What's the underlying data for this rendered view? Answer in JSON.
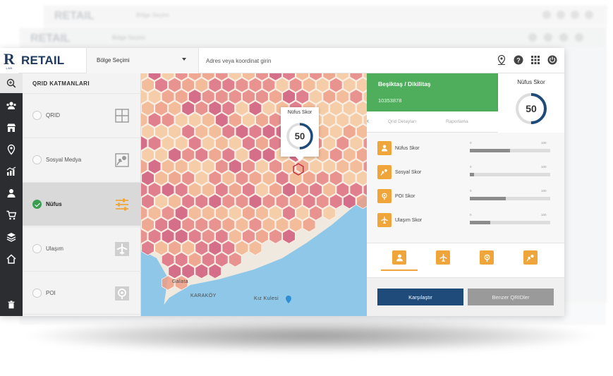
{
  "app": {
    "logo_text": "RETAIL",
    "logo_letter": "R",
    "logo_sub": "LAB",
    "region_select": "Bölge Seçimi",
    "search_placeholder": "Adres veya koordinat girin"
  },
  "ghost": {
    "logo_text": "RETAIL",
    "region_select": "Bölge Seçimi"
  },
  "toolbar": {
    "icons": [
      "map-pin-icon",
      "help-icon",
      "grid-menu-icon",
      "power-icon"
    ]
  },
  "rail": {
    "icons": [
      "layers-search-icon",
      "users-icon",
      "store-icon",
      "location-icon",
      "chart-icon",
      "person-icon",
      "cart-icon",
      "stack-icon",
      "home-icon",
      "trash-icon"
    ]
  },
  "layers": {
    "title": "QRID KATMANLARI",
    "items": [
      {
        "label": "QRID",
        "checked": false,
        "icon": "grid-icon"
      },
      {
        "label": "Sosyal Medya",
        "checked": false,
        "icon": "social-media-icon"
      },
      {
        "label": "Nüfus",
        "checked": true,
        "icon": "sliders-icon"
      },
      {
        "label": "Ulaşım",
        "checked": false,
        "icon": "airplane-icon"
      },
      {
        "label": "POI",
        "checked": false,
        "icon": "poi-icon"
      }
    ]
  },
  "map": {
    "tooltip_title": "Nüfus Skor",
    "tooltip_value": "50",
    "labels": [
      "KARAKÖY",
      "Kız Kulesi",
      "Galata"
    ]
  },
  "panel": {
    "location": "Beşiktaş / Dikilitaş",
    "code": "10353878",
    "score_title": "Nüfus Skor",
    "score_value": "50",
    "score_fraction": 0.5,
    "subhead_left": "Qrid Detayları",
    "subhead_right": "Raporlama",
    "metrics": [
      {
        "label": "Nüfus Skor",
        "value": 0.5,
        "min": "0",
        "max": "100",
        "icon": "person-icon"
      },
      {
        "label": "Sosyal Skor",
        "value": 0.05,
        "min": "0",
        "max": "100",
        "icon": "social-media-icon"
      },
      {
        "label": "POI Skor",
        "value": 0.45,
        "min": "0",
        "max": "100",
        "icon": "poi-icon"
      },
      {
        "label": "Ulaşım Skor",
        "value": 0.25,
        "min": "0",
        "max": "100",
        "icon": "airplane-icon"
      }
    ],
    "tabs": [
      "person-icon",
      "airplane-icon",
      "poi-icon",
      "social-media-icon"
    ],
    "compare_button": "Karşılaştır",
    "similar_button": "Benzer QRIDler"
  },
  "colors": {
    "brand": "#1f3a5c",
    "accent_green": "#4fae5b",
    "accent_orange": "#f0a53a",
    "primary_button": "#1f4b7a",
    "rail": "#2b2d30",
    "water": "#8fc7e8"
  }
}
